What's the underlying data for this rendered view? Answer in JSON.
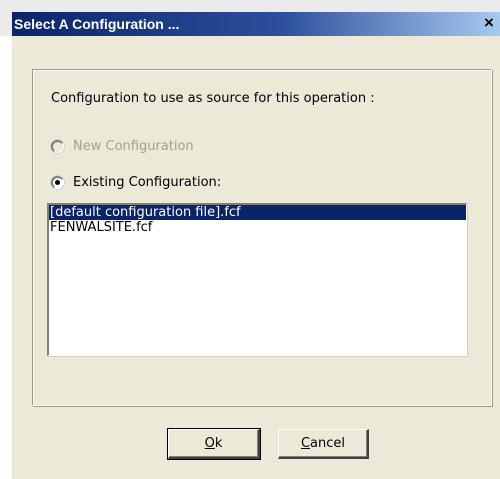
{
  "window": {
    "title": "Select A Configuration ...",
    "close_glyph": "×"
  },
  "prompt": "Configuration to use as source for this operation :",
  "options": {
    "new_configuration": {
      "label": "New Configuration",
      "selected": false,
      "enabled": false
    },
    "existing_configuration": {
      "label": "Existing Configuration:",
      "selected": true,
      "enabled": true
    }
  },
  "configuration_list": {
    "items": [
      {
        "label": "[default configuration file].fcf",
        "selected": true
      },
      {
        "label": "FENWALSITE.fcf",
        "selected": false
      }
    ]
  },
  "buttons": {
    "ok": {
      "accel": "O",
      "rest": "k"
    },
    "cancel": {
      "accel": "C",
      "rest": "ancel"
    }
  },
  "colors": {
    "title_bar_start": "#0a246a",
    "title_bar_end": "#a6caf0",
    "selection": "#0a246a",
    "dialog_face": "#ece9d8"
  }
}
